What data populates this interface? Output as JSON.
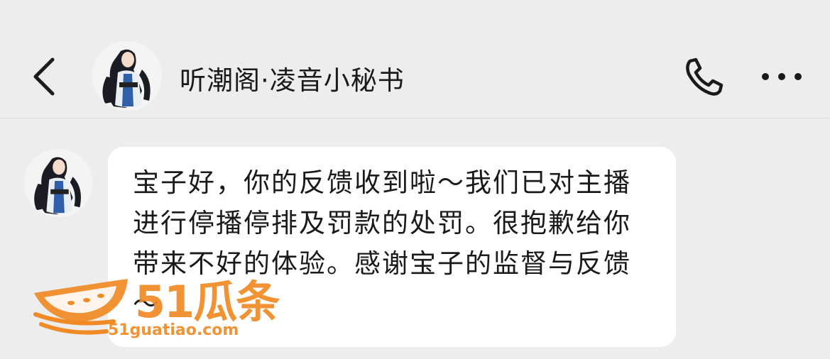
{
  "header": {
    "title": "听潮阁·凌音小秘书",
    "back_icon": "chevron-left-icon",
    "call_icon": "phone-icon",
    "more_icon": "more-dots-icon"
  },
  "message": {
    "text": "宝子好，你的反馈收到啦～我们已对主播进行停播停排及罚款的处罚。很抱歉给你带来不好的体验。感谢宝子的监督与反馈～"
  },
  "watermark": {
    "brand": "51瓜条",
    "url": "51guatiao.com"
  },
  "colors": {
    "background": "#ededed",
    "bubble": "#ffffff",
    "watermark": "#f08a24"
  }
}
